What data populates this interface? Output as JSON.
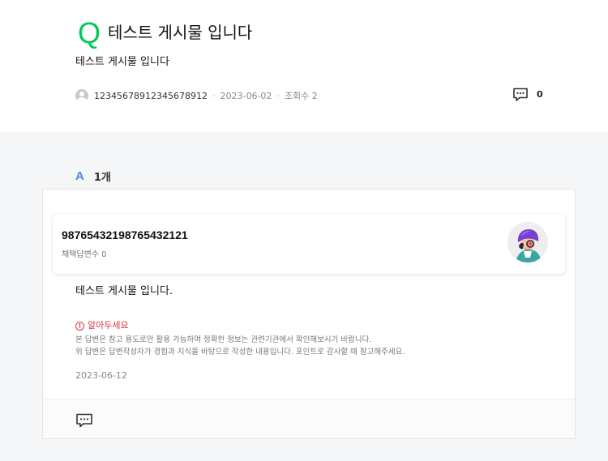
{
  "question": {
    "q_mark": "Q",
    "title": "테스트 게시물 입니다",
    "body": "테스트 게시물 입니다",
    "author": "12345678912345678912",
    "date": "2023-06-02",
    "views": "조회수 2",
    "comment_count": "0"
  },
  "answers": {
    "a_mark": "A",
    "count_label": "1개"
  },
  "answer": {
    "author": "98765432198765432121",
    "adopted_label": "채택답변수 0",
    "body": "테스트 게시물 입니다.",
    "notice_title": "알아두세요",
    "notice_line1": "본 답변은 참고 용도로만 활용 가능하며 정확한 정보는 관련기관에서 확인해보시기 바랍니다.",
    "notice_line2": "위 답변은 답변작성자가 경험과 지식을 바탕으로 작성한 내용입니다. 포인트로 감사할 때 참고해주세요.",
    "date": "2023-06-12"
  },
  "colors": {
    "q_accent": "#03c75a",
    "a_accent": "#4b89dc",
    "warning": "#d8333d"
  },
  "icons": [
    "user-avatar-icon",
    "comment-bubble-icon",
    "warning-icon",
    "profile-avatar-icon"
  ]
}
